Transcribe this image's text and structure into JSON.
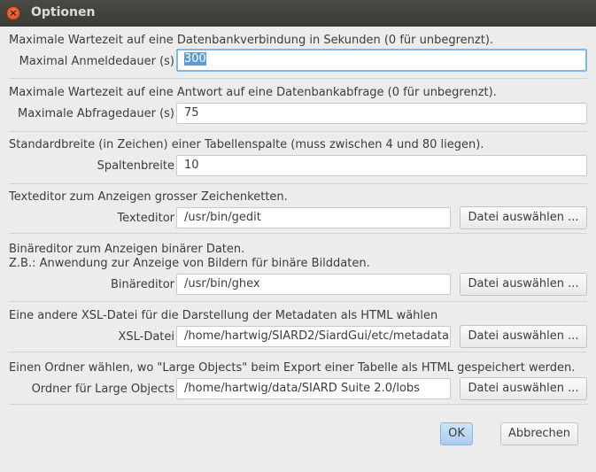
{
  "window": {
    "title": "Optionen",
    "close_symbol": "×"
  },
  "sections": [
    {
      "description": "Maximale Wartezeit auf eine Datenbankverbindung in Sekunden (0 für unbegrenzt).",
      "label": "Maximal Anmeldedauer (s)",
      "value": "300"
    },
    {
      "description": "Maximale Wartezeit auf eine Antwort auf eine Datenbankabfrage (0 für unbegrenzt).",
      "label": "Maximale Abfragedauer (s)",
      "value": "75"
    },
    {
      "description": "Standardbreite (in Zeichen) einer Tabellenspalte (muss zwischen 4 und 80 liegen).",
      "label": "Spaltenbreite",
      "value": "10"
    },
    {
      "description": "Texteditor zum Anzeigen grosser Zeichenketten.",
      "label": "Texteditor",
      "value": "/usr/bin/gedit",
      "button": "Datei auswählen ..."
    },
    {
      "description": "Binäreditor zum Anzeigen binärer Daten.",
      "description2": "Z.B.: Anwendung zur Anzeige von Bildern für binäre Bilddaten.",
      "label": "Binäreditor",
      "value": "/usr/bin/ghex",
      "button": "Datei auswählen ..."
    },
    {
      "description": "Eine andere XSL-Datei für die Darstellung der Metadaten als HTML wählen",
      "label": "XSL-Datei",
      "value": "/home/hartwig/SIARD2/SiardGui/etc/metadata",
      "button": "Datei auswählen ..."
    },
    {
      "description": "Einen Ordner wählen, wo \"Large Objects\" beim Export einer Tabelle als HTML gespeichert werden.",
      "label": "Ordner für Large Objects",
      "value": "/home/hartwig/data/SIARD Suite 2.0/lobs",
      "button": "Datei auswählen ..."
    }
  ],
  "footer": {
    "ok_label": "OK",
    "cancel_label": "Abbrechen"
  },
  "colors": {
    "titlebar": "#3d3d39",
    "background": "#ececec",
    "selection": "#5a9bd8",
    "focus_ring": "#7fb8e6",
    "close_button": "#e0582a"
  }
}
